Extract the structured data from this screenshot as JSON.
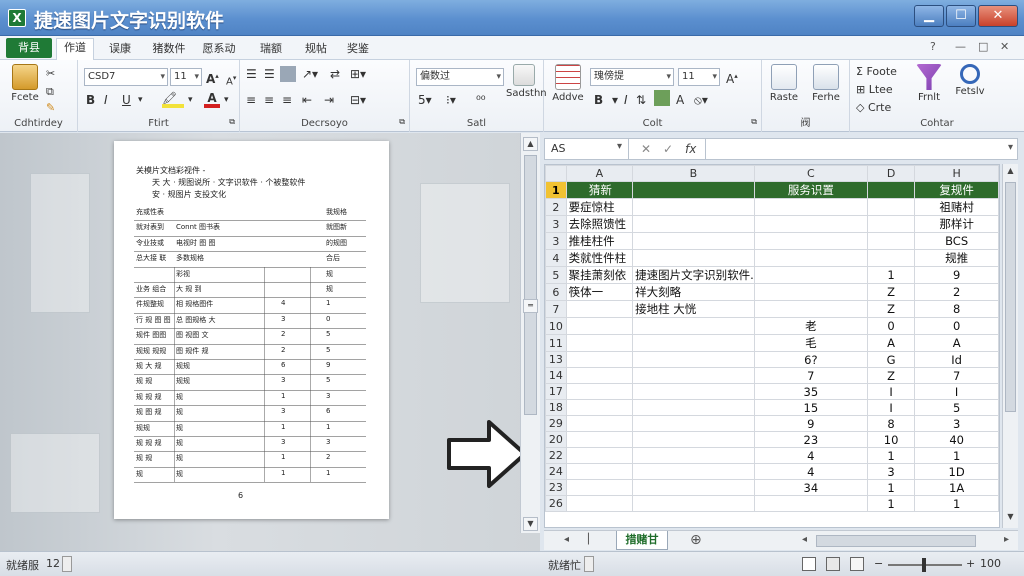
{
  "title": "捷速图片文字识别软件",
  "app_icon": "excel-icon",
  "window_buttons": {
    "min": "▁",
    "max": "☐",
    "close": "✕"
  },
  "menu": {
    "file": "背县",
    "tabs": [
      "作道",
      "误康",
      "猪数件",
      "愿系动",
      "瑞额",
      "规帖",
      "奖鉴"
    ],
    "right_controls": [
      "?",
      "—",
      "□",
      "✕"
    ]
  },
  "ribbon": {
    "clipboard": {
      "paste": "Fcete",
      "label": "Cdhtirdey"
    },
    "font": {
      "font_name": "CSD7",
      "font_size": "11",
      "bold": "B",
      "italic": "I",
      "underline": "U",
      "label": "Ftirt"
    },
    "alignment": {
      "label": "Decrsoyo"
    },
    "number": {
      "format": "偏数过",
      "label": "Satl"
    },
    "styles": {
      "format_combo": "瑰傍提",
      "size": "11",
      "label": "Colt",
      "conditional": "Sadsthn",
      "paste_btn": "Raste"
    },
    "cells": {
      "insert": "Addve",
      "format": "Ferhe",
      "label": "阀"
    },
    "editing": {
      "autosum": "Σ Foote",
      "fill": "Ltee",
      "clear": "Crte",
      "find": "Frnlt",
      "select": "Fetslv",
      "label": "Cohtar"
    }
  },
  "formula_bar": {
    "name_box": "AS",
    "fx": "fx"
  },
  "spreadsheet": {
    "columns": [
      "A",
      "B",
      "C",
      "D",
      "H"
    ],
    "rows": [
      {
        "num": "1",
        "a": "猜新",
        "b": "",
        "c": "服务识置",
        "d": "",
        "h": "复规件"
      },
      {
        "num": "2",
        "a": "要症惊柱",
        "b": "",
        "c": "",
        "d": "",
        "h": "祖赌村"
      },
      {
        "num": "3",
        "a": "去除照馈性",
        "b": "",
        "c": "",
        "d": "",
        "h": "那样计"
      },
      {
        "num": "3",
        "a": "推桂柱件",
        "b": "",
        "c": "",
        "d": "",
        "h": "BCS"
      },
      {
        "num": "4",
        "a": "类就性件柱",
        "b": "",
        "c": "",
        "d": "",
        "h": "规推"
      },
      {
        "num": "5",
        "a": "聚挂萧刻依",
        "b": "捷速图片文字识别软件.",
        "c": "",
        "d": "1",
        "h": "9"
      },
      {
        "num": "6",
        "a": "筷体一",
        "b": "祥大刻略",
        "c": "",
        "d": "Z",
        "h": "2"
      },
      {
        "num": "7",
        "a": "",
        "b": "接地柱 大恍",
        "c": "",
        "d": "Z",
        "h": "8"
      },
      {
        "num": "10",
        "a": "",
        "b": "",
        "c": "老",
        "d": "0",
        "h": "0"
      },
      {
        "num": "11",
        "a": "",
        "b": "",
        "c": "毛",
        "d": "A",
        "h": "A"
      },
      {
        "num": "13",
        "a": "",
        "b": "",
        "c": "6?",
        "d": "G",
        "h": "Id"
      },
      {
        "num": "14",
        "a": "",
        "b": "",
        "c": "7",
        "d": "Z",
        "h": "7"
      },
      {
        "num": "17",
        "a": "",
        "b": "",
        "c": "35",
        "d": "I",
        "h": "I"
      },
      {
        "num": "18",
        "a": "",
        "b": "",
        "c": "15",
        "d": "I",
        "h": "5"
      },
      {
        "num": "29",
        "a": "",
        "b": "",
        "c": "9",
        "d": "8",
        "h": "3"
      },
      {
        "num": "20",
        "a": "",
        "b": "",
        "c": "23",
        "d": "10",
        "h": "40"
      },
      {
        "num": "22",
        "a": "",
        "b": "",
        "c": "4",
        "d": "1",
        "h": "1"
      },
      {
        "num": "24",
        "a": "",
        "b": "",
        "c": "4",
        "d": "3",
        "h": "1D"
      },
      {
        "num": "23",
        "a": "",
        "b": "",
        "c": "34",
        "d": "1",
        "h": "1A"
      },
      {
        "num": "26",
        "a": "",
        "b": "",
        "c": "",
        "d": "1",
        "h": "1"
      }
    ],
    "sheet_tab": "措赌甘",
    "add_sheet": "⊕"
  },
  "document": {
    "line1": "关模片文档彩视件 -",
    "line2": "天 大 · 规图说所 · 文字识软件 · 个被整软件",
    "line3": "安 · 规图片 支投文化",
    "rows": [
      [
        "充或性表",
        "",
        "",
        "我规格"
      ],
      [
        "就对表到",
        "Connt 图书表",
        "",
        "就图新"
      ],
      [
        "令业技或",
        "电视时 图 图",
        "",
        "的规图"
      ],
      [
        "总大接 联",
        "多数规格",
        "",
        "合后"
      ],
      [
        "",
        "彩视",
        "",
        "规"
      ],
      [
        "业务 组合",
        "大 规 到",
        "",
        "规"
      ],
      [
        "件规整规",
        "相 规格图件",
        "4",
        "1"
      ],
      [
        "行 规 图 图",
        "总 图规格 大",
        "3",
        "0"
      ],
      [
        "规件 图图",
        "图 视图 文",
        "2",
        "5"
      ],
      [
        "规规 规规",
        "图 规件 规",
        "2",
        "5"
      ],
      [
        "规 大 规",
        "规规",
        "6",
        "9"
      ],
      [
        "规 规",
        "规规",
        "3",
        "5"
      ],
      [
        "规 规 规",
        "规",
        "1",
        "3"
      ],
      [
        "规 图 规",
        "规",
        "3",
        "6"
      ],
      [
        "规规",
        "规",
        "1",
        "1"
      ],
      [
        "规 规 规",
        "规",
        "3",
        "3"
      ],
      [
        "规 规",
        "规",
        "1",
        "2"
      ],
      [
        "规",
        "规",
        "1",
        "1"
      ]
    ],
    "page_num": "6"
  },
  "status": {
    "left": "就绪服",
    "count": "12",
    "mid": "就绪忙",
    "zoom": "100"
  }
}
